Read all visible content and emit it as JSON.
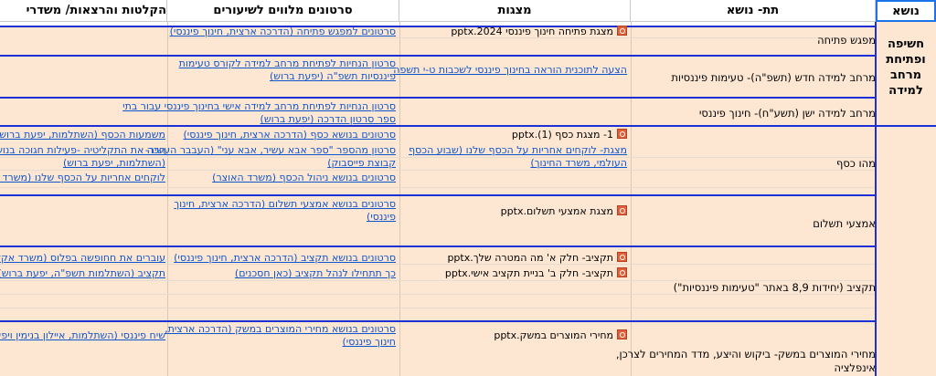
{
  "headers": {
    "topic": "נושא",
    "subtopic": "תת- נושא",
    "presentations": "מצגות",
    "videos": "סרטונים מלווים לשיעורים",
    "recordings": "הקלטות והרצאות/ משדרי"
  },
  "topics": {
    "t1": "חשיפה ופתיחת מרחב למידה"
  },
  "subtopics": {
    "s1": "מפגש פתיחה",
    "s2": "מרחב למידה חדש (תשפ\"ה)- טעימות פיננסיות",
    "s3": "מרחב למידה ישן (תשע\"ח)- חינוך פיננסי",
    "s4": "מהו כסף",
    "s5": "אמצעי תשלום",
    "s6": "תקציב (יחידות 8,9 באתר \"טעימות פיננסיות\")",
    "s7a": "מחירי המוצרים במשק- ביקוש והיצע, מדד המחירים לצרכן,",
    "s7b": "אינפלציה"
  },
  "presentations": {
    "p1": "מצגת פתיחה חינוך פיננסי 2024.pptx",
    "p2": "הצעה לתוכנית הוראה בחינוך פיננסי לשכבות ט-י תשפה",
    "p3": "1- מצגת כסף (1).pptx",
    "p4a": "מצגת- לוקחים אחריות על הכסף שלנו (שבוע הכסף",
    "p4b": "העולמי, משרד החינוך)",
    "p5": "מצגת אמצעי תשלום.pptx",
    "p6": "תקציב- חלק א' מה המטרה שלך.pptx",
    "p7": "תקציב- חלק ב' בניית תקציב אישי.pptx",
    "p8": "מחירי המוצרים במשק.pptx"
  },
  "videos": {
    "v1": "סרטונים למפגש פתיחה (הדרכה ארצית, חינוך פיננסי)",
    "v2a": "סרטון הנחיות לפתיחת מרחב למידה לקורס טעימות",
    "v2b": "פיננסיות תשפ\"ה (יפעת ברוש)",
    "v3a": "סרטון הנחיות לפתיחת מרחב למידה אישי בחינוך פיננסי עבור בתי",
    "v3b": "ספר סרטון הדרכה (יפעת ברוש)",
    "v4": "סרטונים בנושא כסף (הדרכה ארצית, חינוך פיננסי)",
    "v5a": "סרטון מהספר \"ספר אבא עשיר, אבא עני\" (העבבר העשיר-",
    "v5b": "קבוצת פייסבוק)",
    "v6": "סרטונים בנושא ניהול הכסף (משרד האוצר)",
    "v7a": "סרטונים בנושא אמצעי תשלום (הדרכה ארצית, חינוך",
    "v7b": "פיננסי)",
    "v8": "סרטונים בנושא תקציב (הדרכה ארצית, חינוך פיננסי)",
    "v9": "כך תתחילו לנהל תקציב (כאן חסכנים)",
    "v10a": "סרטונים בנושא מחירי המוצרים במשק (הדרכה ארצית,",
    "v10b": "חינוך פיננסי)"
  },
  "recordings": {
    "r1": "משמעות הכסף (השתלמות, יפעת ברוש)",
    "r2a": "הכה את התקליטיה -פעילות חגוכה בנושא:",
    "r2b": "(השתלמות, יפעת ברוש)",
    "r3": "לוקחים אחריות על הכסף שלנו (משרד אקד",
    "r4": "עוברים את חחופשה בפלוס (משרד אקדמיה",
    "r5": "תקציב (השתלמות תשפ\"ה, יפעת ברוש)",
    "r6": "שיח פיננסי (השתלמות, איילון בנימין ויפעת"
  },
  "colors": {
    "peach": "#fde7d3",
    "blue_line": "#1f2fd6",
    "link": "#1155cc",
    "grid": "#e6dccf"
  }
}
